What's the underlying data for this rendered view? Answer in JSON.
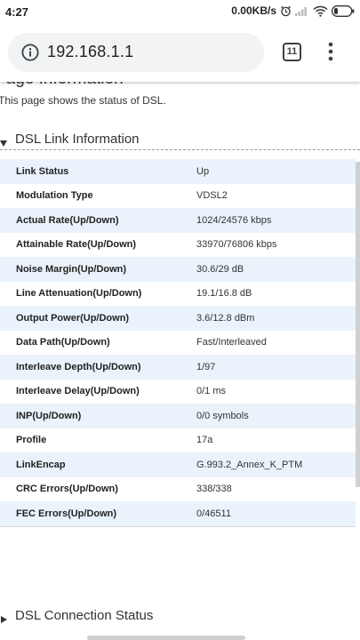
{
  "status_bar": {
    "time": "4:27",
    "network_speed": "0.00KB/s"
  },
  "browser": {
    "url": "192.168.1.1",
    "tab_count": "11"
  },
  "page": {
    "title": "Page Information",
    "description": "This page shows the status of DSL.",
    "sections": [
      {
        "label": "DSL Link Information",
        "expanded": true
      },
      {
        "label": "DSL Connection Status",
        "expanded": false
      }
    ]
  },
  "dsl_link": {
    "rows": [
      {
        "key": "Link Status",
        "value": "Up"
      },
      {
        "key": "Modulation Type",
        "value": "VDSL2"
      },
      {
        "key": "Actual Rate(Up/Down)",
        "value": "1024/24576 kbps"
      },
      {
        "key": "Attainable Rate(Up/Down)",
        "value": "33970/76806 kbps"
      },
      {
        "key": "Noise Margin(Up/Down)",
        "value": "30.6/29 dB"
      },
      {
        "key": "Line Attenuation(Up/Down)",
        "value": "19.1/16.8 dB"
      },
      {
        "key": "Output Power(Up/Down)",
        "value": "3.6/12.8 dBm"
      },
      {
        "key": "Data Path(Up/Down)",
        "value": "Fast/Interleaved"
      },
      {
        "key": "Interleave Depth(Up/Down)",
        "value": "1/97"
      },
      {
        "key": "Interleave Delay(Up/Down)",
        "value": "0/1 ms"
      },
      {
        "key": "INP(Up/Down)",
        "value": "0/0 symbols"
      },
      {
        "key": "Profile",
        "value": "17a"
      },
      {
        "key": "LinkEncap",
        "value": "G.993.2_Annex_K_PTM"
      },
      {
        "key": "CRC Errors(Up/Down)",
        "value": "338/338"
      },
      {
        "key": "FEC Errors(Up/Down)",
        "value": "0/46511"
      }
    ]
  },
  "colors": {
    "row_alt": "#eaf3fb",
    "url_pill": "#f1f3f4"
  }
}
